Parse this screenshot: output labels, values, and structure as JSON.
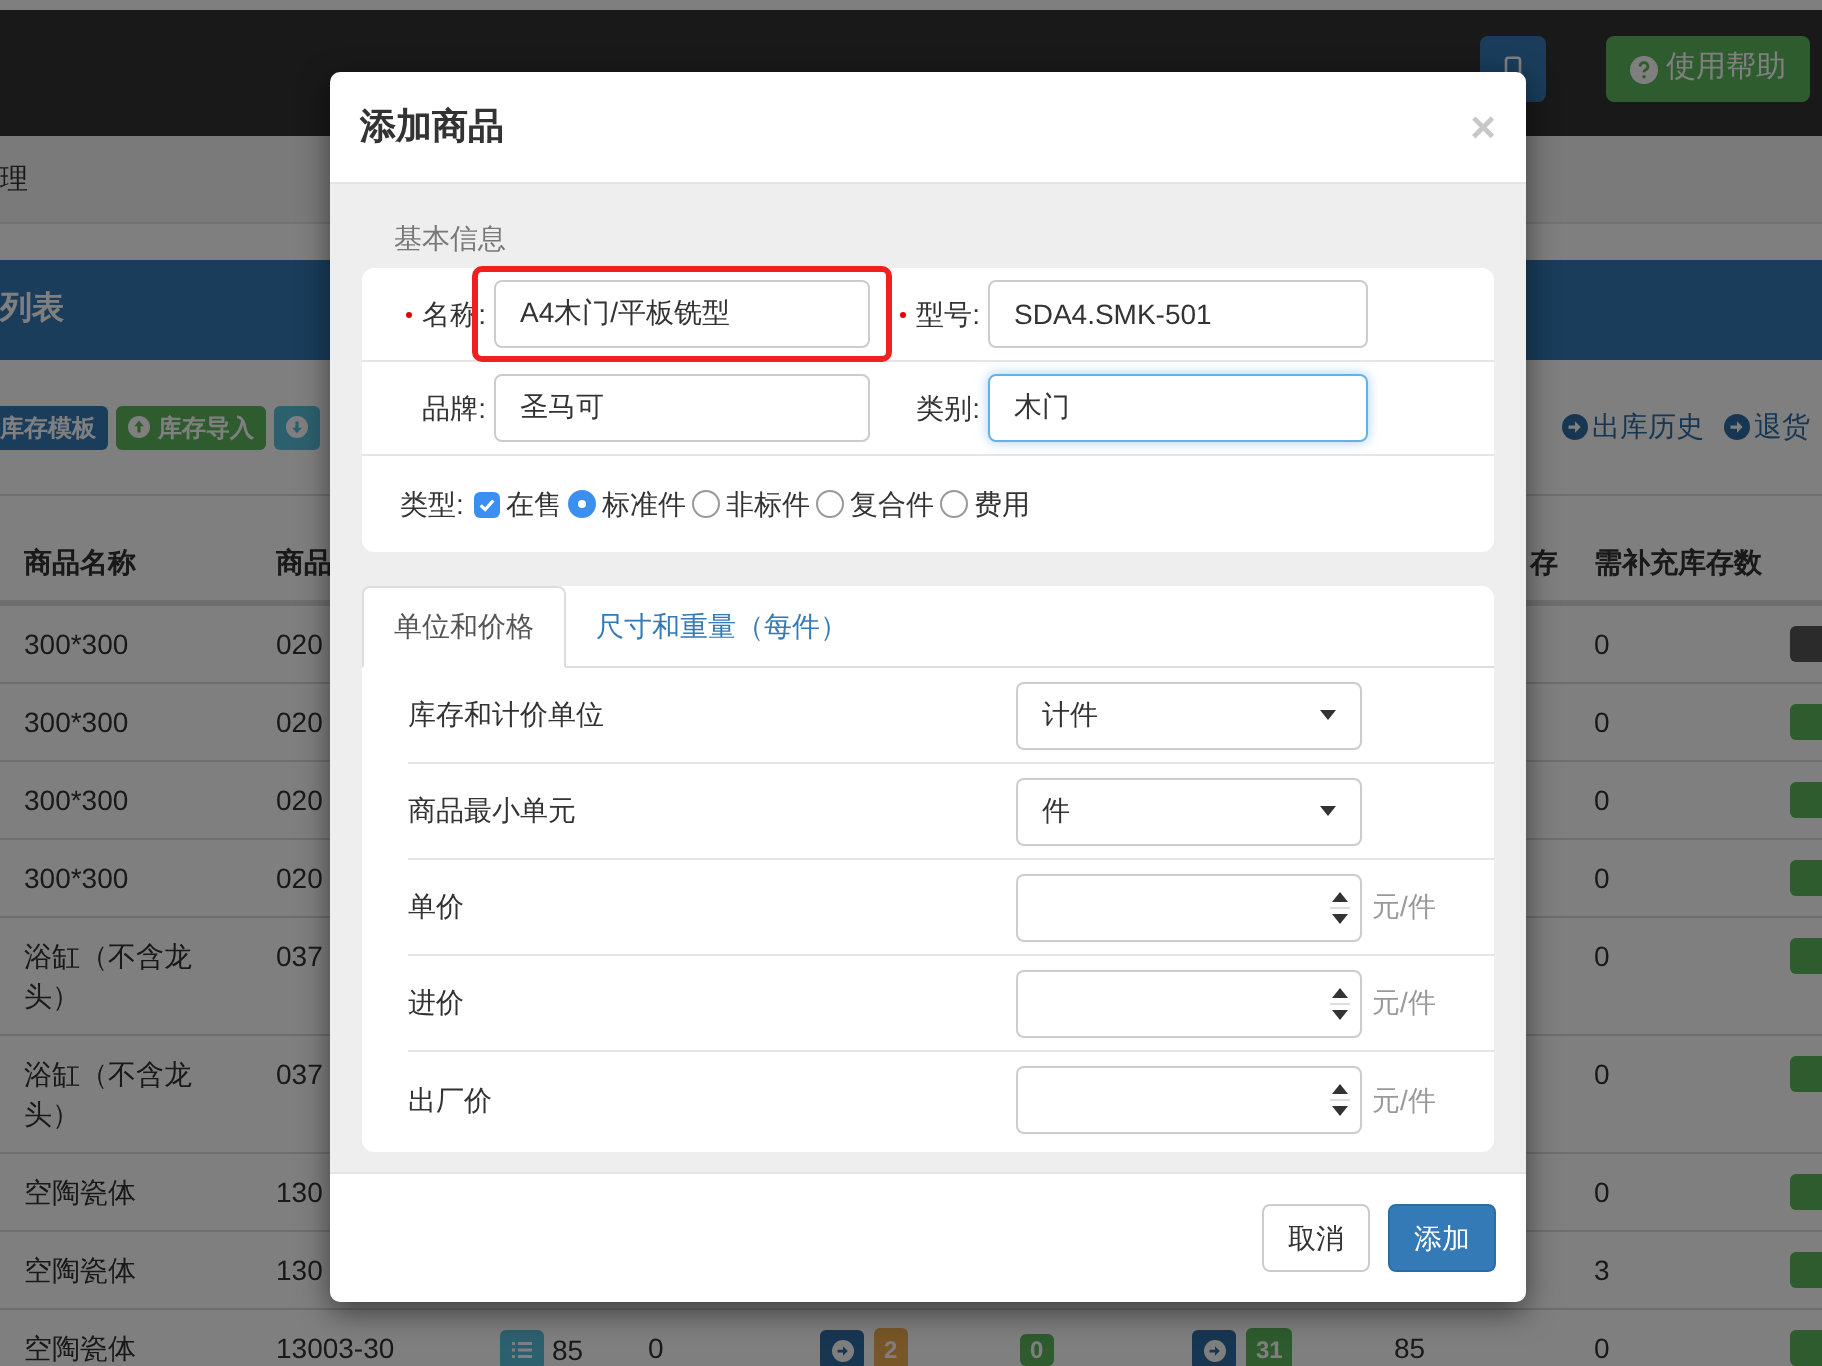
{
  "navbar": {
    "buttons": [
      {
        "kind": "phone"
      },
      {
        "label": "使用帮助",
        "kind": "help"
      }
    ]
  },
  "breadcrumb": "理",
  "panel_title": "列表",
  "toolbar": {
    "left": [
      {
        "label": "库存模板",
        "kind": "plain"
      },
      {
        "label": "库存导入",
        "kind": "upload"
      },
      {
        "kind": "download"
      }
    ],
    "right": [
      {
        "label": "出库历史"
      },
      {
        "label": "退货"
      }
    ]
  },
  "table": {
    "columns": [
      "商品名称",
      "商品",
      "存",
      "需补充库存数"
    ],
    "rows": [
      {
        "name": "300*300",
        "code": "020",
        "restock": "0",
        "color": "#2b2b2b"
      },
      {
        "name": "300*300",
        "code": "020",
        "restock": "0",
        "color": "#2e5c2e"
      },
      {
        "name": "300*300",
        "code": "020",
        "restock": "0",
        "color": "#2e5c2e"
      },
      {
        "name": "300*300",
        "code": "020",
        "restock": "0",
        "color": "#2e5c2e"
      },
      {
        "name": "浴缸（不含龙头）",
        "code": "037",
        "restock": "0",
        "color": "#2e5c2e"
      },
      {
        "name": "浴缸（不含龙头）",
        "code": "037",
        "restock": "0",
        "color": "#2e5c2e"
      },
      {
        "name": "空陶瓷体",
        "code": "130",
        "restock": "0",
        "color": "#2e5c2e"
      },
      {
        "name": "空陶瓷体",
        "code": "130",
        "restock": "3",
        "color": "#2e5c2e"
      },
      {
        "name": "空陶瓷体",
        "code": "13003-30",
        "column_3": "85",
        "column_4": "0",
        "column_5": "2",
        "column_6": "0",
        "column_7": "31",
        "column_8": "85",
        "restock": "0",
        "color": "#2e5c2e"
      }
    ]
  },
  "modal": {
    "title": "添加商品",
    "close": "×",
    "section_title": "基本信息",
    "fields": [
      {
        "label": "名称:",
        "required": true,
        "value": "A4木门/平板铣型",
        "highlighted": true,
        "focused": false
      },
      {
        "label": "型号:",
        "required": true,
        "value": "SDA4.SMK-501",
        "highlighted": false,
        "focused": false
      },
      {
        "label": "品牌:",
        "required": false,
        "value": "圣马可",
        "highlighted": false,
        "focused": false
      },
      {
        "label": "类别:",
        "required": false,
        "value": "木门",
        "highlighted": false,
        "focused": true
      }
    ],
    "type_label": "类型:",
    "options": [
      {
        "kind": "checkbox",
        "label": "在售",
        "checked": true
      },
      {
        "kind": "radio",
        "label": "标准件",
        "selected": true
      },
      {
        "kind": "radio",
        "label": "非标件",
        "selected": false
      },
      {
        "kind": "radio",
        "label": "复合件",
        "selected": false
      },
      {
        "kind": "radio",
        "label": "费用",
        "selected": false
      }
    ],
    "tabs": [
      {
        "label": "单位和价格",
        "selected": true
      },
      {
        "label": "尺寸和重量（每件）",
        "selected": false
      }
    ],
    "rows": [
      {
        "kind": "select",
        "label": "库存和计价单位",
        "value": "计件"
      },
      {
        "kind": "select",
        "label": "商品最小单元",
        "value": "件"
      },
      {
        "kind": "number",
        "label": "单价",
        "unit": "元/件"
      },
      {
        "kind": "number",
        "label": "进价",
        "unit": "元/件"
      },
      {
        "kind": "number",
        "label": "出厂价",
        "unit": "元/件"
      }
    ],
    "buttons": [
      {
        "label": "取消",
        "kind": "default"
      },
      {
        "label": "添加",
        "kind": "primary"
      }
    ]
  }
}
